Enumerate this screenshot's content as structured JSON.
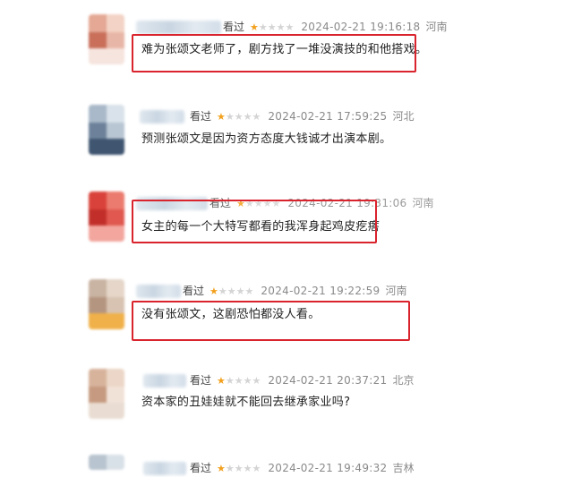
{
  "comments": [
    {
      "status": "看过",
      "rating": 1,
      "timestamp": "2024-02-21 19:16:18",
      "location": "河南",
      "text": "难为张颂文老师了，剧方找了一堆没演技的和他搭戏。",
      "highlighted": true
    },
    {
      "status": "看过",
      "rating": 1,
      "timestamp": "2024-02-21 17:59:25",
      "location": "河北",
      "text": "预测张颂文是因为资方态度大钱诚才出演本剧。",
      "highlighted": false
    },
    {
      "status": "看过",
      "rating": 1,
      "timestamp": "2024-02-21 19:31:06",
      "location": "河南",
      "text": "女主的每一个大特写都看的我浑身起鸡皮疙瘩",
      "highlighted": true
    },
    {
      "status": "看过",
      "rating": 1,
      "timestamp": "2024-02-21 19:22:59",
      "location": "河南",
      "text": "没有张颂文，这剧恐怕都没人看。",
      "highlighted": true
    },
    {
      "status": "看过",
      "rating": 1,
      "timestamp": "2024-02-21 20:37:21",
      "location": "北京",
      "text": "资本家的丑娃娃就不能回去继承家业吗?",
      "highlighted": false
    },
    {
      "status": "看过",
      "rating": 1,
      "timestamp": "2024-02-21 19:49:32",
      "location": "吉林",
      "text": "",
      "highlighted": false
    }
  ],
  "colors": {
    "highlight": "#d9232d",
    "star_on": "#f2a01d",
    "star_off": "#d4d4d4"
  }
}
